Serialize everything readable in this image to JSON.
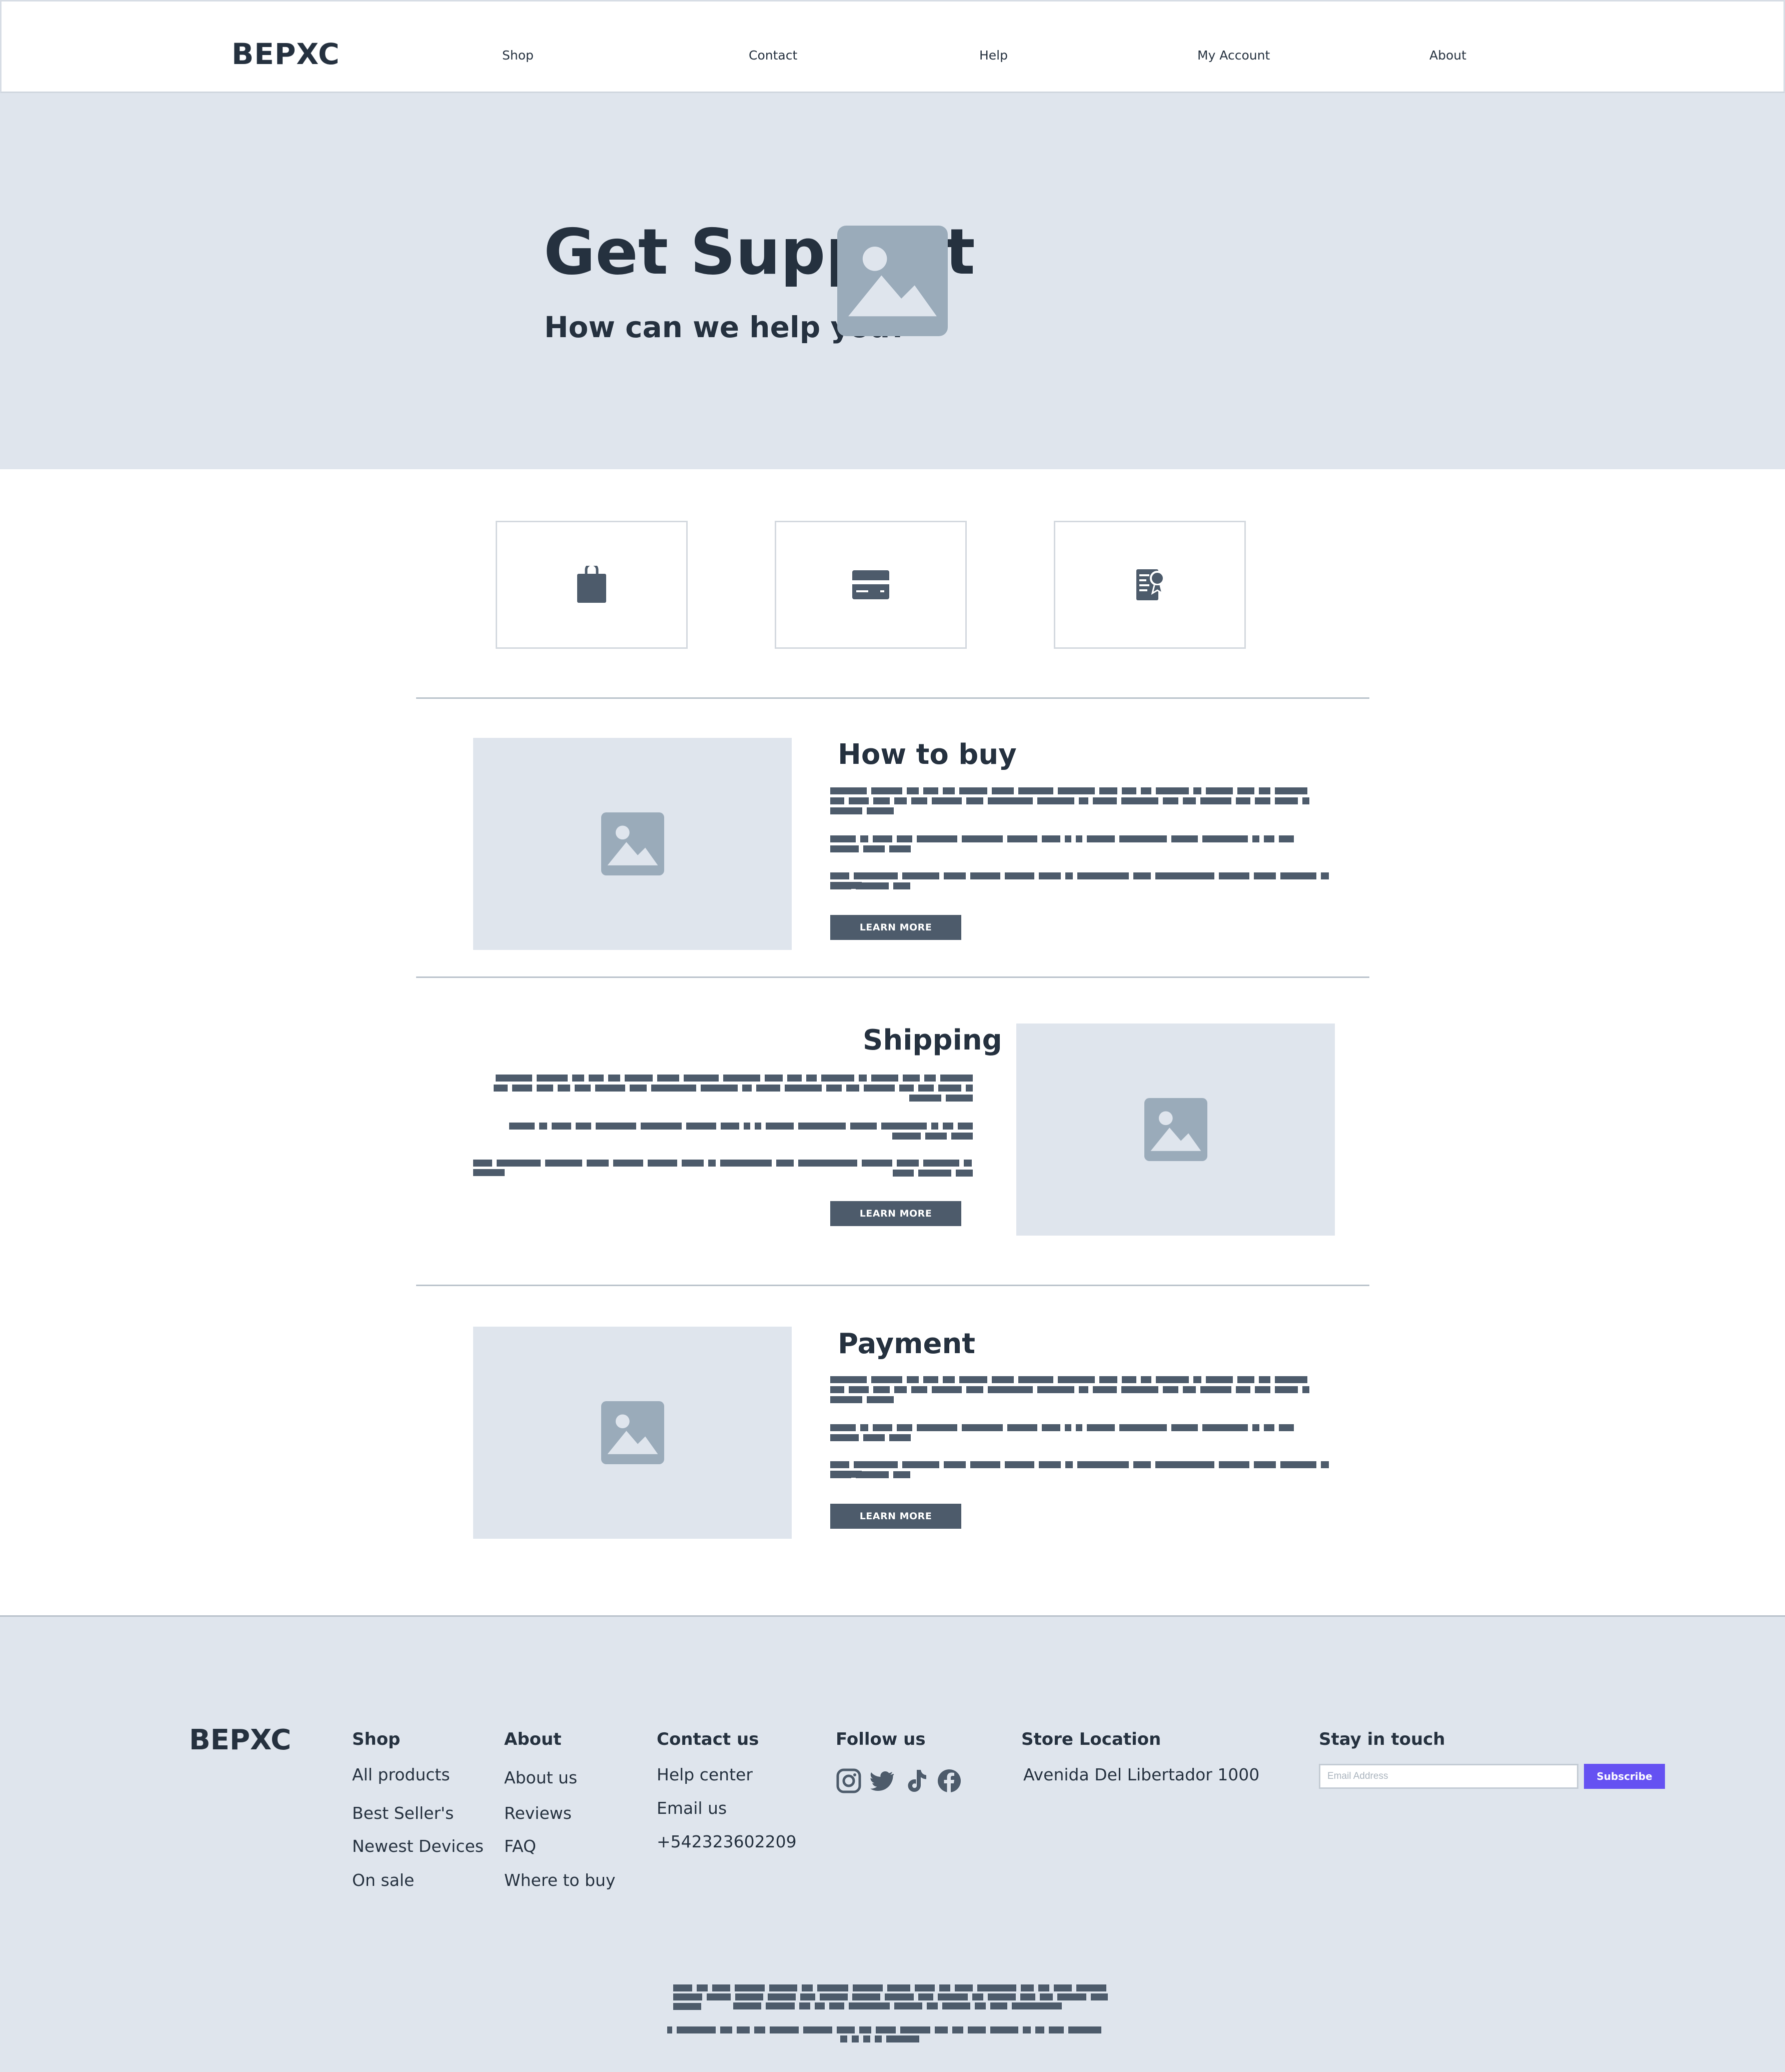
{
  "brand": "BEPXC",
  "nav": {
    "items": [
      "Shop",
      "Contact",
      "Help",
      "My Account",
      "About"
    ]
  },
  "hero": {
    "title": "Get Support",
    "subtitle": "How can we help you?",
    "image_icon": "image-placeholder-icon"
  },
  "categories": [
    {
      "icon": "shopping-bag-icon"
    },
    {
      "icon": "credit-card-icon"
    },
    {
      "icon": "receipt-icon"
    }
  ],
  "sections": [
    {
      "title": "How to buy",
      "button": "LEARN MORE",
      "image_icon": "image-placeholder-icon"
    },
    {
      "title": "Shipping",
      "button": "LEARN MORE",
      "image_icon": "image-placeholder-icon"
    },
    {
      "title": "Payment",
      "button": "LEARN MORE",
      "image_icon": "image-placeholder-icon"
    }
  ],
  "footer": {
    "brand": "BEPXC",
    "shop": {
      "heading": "Shop",
      "links": [
        "All products",
        "Best Seller's",
        "Newest Devices",
        "On sale"
      ]
    },
    "about": {
      "heading": "About",
      "links": [
        "About us",
        "Reviews",
        "FAQ",
        "Where to buy"
      ]
    },
    "contact": {
      "heading": "Contact us",
      "links": [
        "Help center",
        "Email us",
        "+542323602209"
      ]
    },
    "follow": {
      "heading": "Follow us",
      "icons": [
        "instagram-icon",
        "twitter-icon",
        "tiktok-icon",
        "facebook-icon"
      ]
    },
    "store": {
      "heading": "Store Location",
      "address": "Avenida Del Libertador 1000"
    },
    "newsletter": {
      "heading": "Stay in touch",
      "placeholder": "Email Address",
      "button": "Subscribe"
    }
  },
  "colors": {
    "text": "#25313f",
    "hero_bg": "#dfe5ed",
    "placeholder_icon": "#9aabba",
    "button_bg": "#4d5b6b",
    "subscribe_bg": "#6551f2"
  }
}
